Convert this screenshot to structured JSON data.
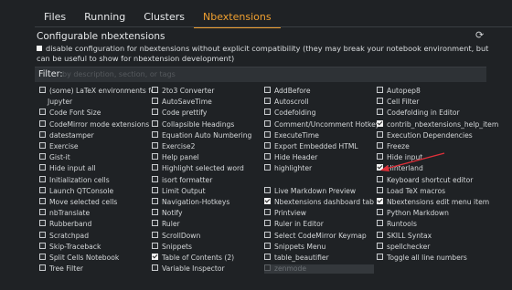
{
  "tabs": [
    "Files",
    "Running",
    "Clusters",
    "Nbextensions"
  ],
  "active_tab": "Nbextensions",
  "config_title": "Configurable nbextensions",
  "disable_text": "disable configuration for nbextensions without explicit compatibility (they may break your notebook environment, but can be useful to show for nbextension development)",
  "filter": {
    "label": "Filter:",
    "placeholder": "by description, section, or tags",
    "value": ""
  },
  "columns": [
    [
      {
        "label": "(some) LaTeX environments for",
        "checked": false
      },
      {
        "label": "Jupyter",
        "checked": false,
        "continuation": true
      },
      {
        "label": "Code Font Size",
        "checked": false
      },
      {
        "label": "CodeMirror mode extensions",
        "checked": false
      },
      {
        "label": "datestamper",
        "checked": false
      },
      {
        "label": "Exercise",
        "checked": false
      },
      {
        "label": "Gist-it",
        "checked": false
      },
      {
        "label": "Hide input all",
        "checked": false
      },
      {
        "label": "Initialization cells",
        "checked": false
      },
      {
        "label": "Launch QTConsole",
        "checked": false
      },
      {
        "label": "Move selected cells",
        "checked": false
      },
      {
        "label": "nbTranslate",
        "checked": false
      },
      {
        "label": "Rubberband",
        "checked": false
      },
      {
        "label": "Scratchpad",
        "checked": false
      },
      {
        "label": "Skip-Traceback",
        "checked": false
      },
      {
        "label": "Split Cells Notebook",
        "checked": false
      },
      {
        "label": "Tree Filter",
        "checked": false
      }
    ],
    [
      {
        "label": "2to3 Converter",
        "checked": false
      },
      {
        "label": "AutoSaveTime",
        "checked": false
      },
      {
        "label": "Code prettify",
        "checked": false
      },
      {
        "label": "Collapsible Headings",
        "checked": false
      },
      {
        "label": "Equation Auto Numbering",
        "checked": false
      },
      {
        "label": "Exercise2",
        "checked": false
      },
      {
        "label": "Help panel",
        "checked": false
      },
      {
        "label": "Highlight selected word",
        "checked": false
      },
      {
        "label": "isort formatter",
        "checked": false
      },
      {
        "label": "Limit Output",
        "checked": false
      },
      {
        "label": "Navigation-Hotkeys",
        "checked": false
      },
      {
        "label": "Notify",
        "checked": false
      },
      {
        "label": "Ruler",
        "checked": false
      },
      {
        "label": "ScrollDown",
        "checked": false
      },
      {
        "label": "Snippets",
        "checked": false
      },
      {
        "label": "Table of Contents (2)",
        "checked": true
      },
      {
        "label": "Variable Inspector",
        "checked": false
      }
    ],
    [
      {
        "label": "AddBefore",
        "checked": false
      },
      {
        "label": "Autoscroll",
        "checked": false
      },
      {
        "label": "Codefolding",
        "checked": false
      },
      {
        "label": "Comment/Uncomment Hotkey",
        "checked": false
      },
      {
        "label": "ExecuteTime",
        "checked": false
      },
      {
        "label": "Export Embedded HTML",
        "checked": false
      },
      {
        "label": "Hide Header",
        "checked": false
      },
      {
        "label": "highlighter",
        "checked": false
      },
      {
        "label": "",
        "checked": false,
        "blank": true
      },
      {
        "label": "Live Markdown Preview",
        "checked": false
      },
      {
        "label": "Nbextensions dashboard tab",
        "checked": true
      },
      {
        "label": "Printview",
        "checked": false
      },
      {
        "label": "Ruler in Editor",
        "checked": false
      },
      {
        "label": "Select CodeMirror Keymap",
        "checked": false
      },
      {
        "label": "Snippets Menu",
        "checked": false
      },
      {
        "label": "table_beautifier",
        "checked": false
      },
      {
        "label": "zenmode",
        "checked": false,
        "disabled": true,
        "selected": true
      }
    ],
    [
      {
        "label": "Autopep8",
        "checked": false
      },
      {
        "label": "Cell Filter",
        "checked": false
      },
      {
        "label": "Codefolding in Editor",
        "checked": false
      },
      {
        "label": "contrib_nbextensions_help_item",
        "checked": true
      },
      {
        "label": "Execution Dependencies",
        "checked": false
      },
      {
        "label": "Freeze",
        "checked": false
      },
      {
        "label": "Hide input",
        "checked": false
      },
      {
        "label": "Hinterland",
        "checked": true
      },
      {
        "label": "Keyboard shortcut editor",
        "checked": false
      },
      {
        "label": "Load TeX macros",
        "checked": false
      },
      {
        "label": "Nbextensions edit menu item",
        "checked": true
      },
      {
        "label": "Python Markdown",
        "checked": false
      },
      {
        "label": "Runtools",
        "checked": false
      },
      {
        "label": "SKILL Syntax",
        "checked": false
      },
      {
        "label": "spellchecker",
        "checked": false
      },
      {
        "label": "Toggle all line numbers",
        "checked": false
      }
    ]
  ],
  "annotation_arrow_color": "#e0303a"
}
